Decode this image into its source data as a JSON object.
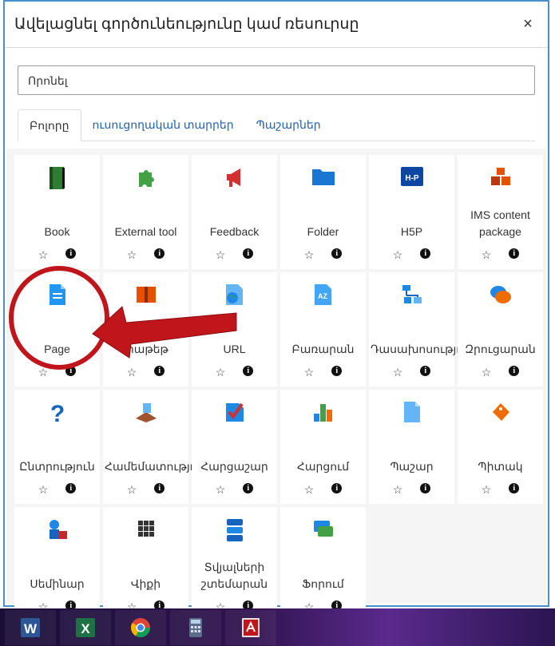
{
  "dialog": {
    "title": "Ավելացնել գործունեությունը կամ ռեսուրսը",
    "close_label": "×"
  },
  "search": {
    "placeholder": "Որոնել"
  },
  "tabs": [
    {
      "label": "Բոլորը",
      "active": true
    },
    {
      "label": "ուսուցողական տարրեր",
      "active": false
    },
    {
      "label": "Պաշարներ",
      "active": false
    }
  ],
  "tiles": [
    {
      "label": "Book",
      "icon": "book-icon"
    },
    {
      "label": "External tool",
      "icon": "puzzle-icon"
    },
    {
      "label": "Feedback",
      "icon": "megaphone-icon"
    },
    {
      "label": "Folder",
      "icon": "folder-icon"
    },
    {
      "label": "H5P",
      "icon": "h5p-icon"
    },
    {
      "label": "IMS content package",
      "icon": "package-icon"
    },
    {
      "label": "Page",
      "icon": "page-icon"
    },
    {
      "label": "SCORM փաթեթ",
      "icon": "scorm-icon"
    },
    {
      "label": "URL",
      "icon": "globe-icon"
    },
    {
      "label": "Բառարան",
      "icon": "glossary-icon"
    },
    {
      "label": "Դասախոսություն",
      "icon": "lesson-icon"
    },
    {
      "label": "Զրուցարան",
      "icon": "chat-icon"
    },
    {
      "label": "Ընտրություն",
      "icon": "question-icon"
    },
    {
      "label": "Համեմատություն",
      "icon": "workshop-icon"
    },
    {
      "label": "Հարցաշար",
      "icon": "checkbox-icon"
    },
    {
      "label": "Հարցում",
      "icon": "bar-chart-icon"
    },
    {
      "label": "Պաշար",
      "icon": "file-icon"
    },
    {
      "label": "Պիտակ",
      "icon": "tag-icon"
    },
    {
      "label": "Սեմինար",
      "icon": "seminar-icon"
    },
    {
      "label": "Վիքի",
      "icon": "wiki-icon"
    },
    {
      "label": "Տվյալների շտեմարան",
      "icon": "database-icon"
    },
    {
      "label": "Ֆորում",
      "icon": "forum-icon"
    }
  ],
  "tile_actions": {
    "star": "☆",
    "info": "i"
  },
  "taskbar": {
    "apps": [
      "word-icon",
      "excel-icon",
      "chrome-icon",
      "calculator-icon",
      "acrobat-icon"
    ]
  },
  "colors": {
    "dialog_border": "#4a90c8",
    "link": "#1f5fb0",
    "annotation_red": "#c0161b",
    "taskbar": "#30134f"
  }
}
